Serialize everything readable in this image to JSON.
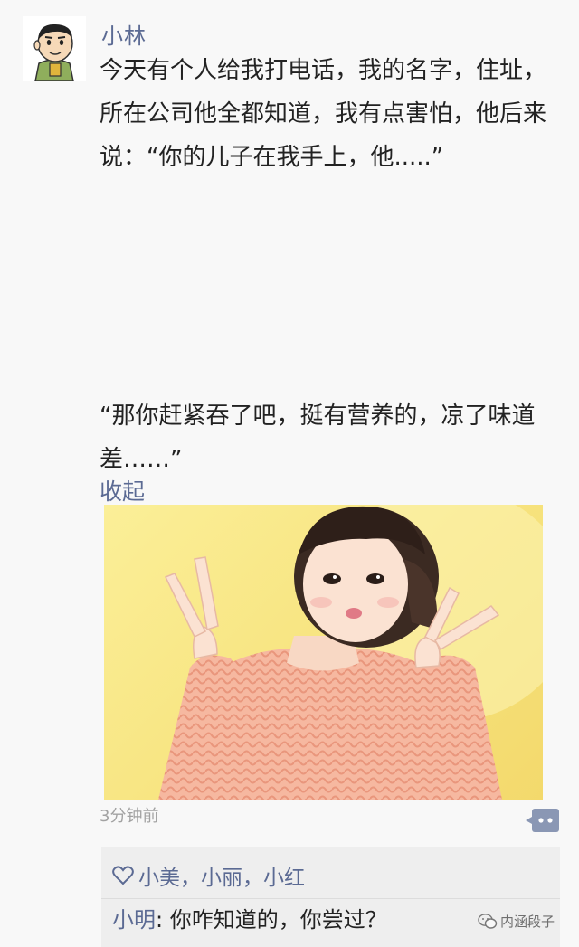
{
  "post": {
    "author": "小林",
    "avatar_icon": "cartoon-man-avatar-icon",
    "text_lines": [
      "今天有个人给我打电话，我的名字，住址，",
      "所在公司他全都知道，我有点害怕，他后来",
      "说：“你的儿子在我手上，他.....”"
    ],
    "text2_lines": [
      "“那你赶紧吞了吧，挺有营养的，凉了味道",
      "差……”"
    ],
    "collapse_label": "收起",
    "image_icon": "photo-girl-peace-sign",
    "time": "3分钟前",
    "comment_icon": "comment-dots-icon"
  },
  "likes": {
    "icon": "heart-icon",
    "names": "小美，小丽，小红"
  },
  "comment": {
    "author": "小明",
    "separator": ": ",
    "text": "你咋知道的，你尝过？"
  },
  "watermark": {
    "icon": "wechat-icon",
    "text": "内涵段子"
  },
  "colors": {
    "link": "#5b6a93",
    "text": "#222222",
    "meta": "#a2a2a2",
    "likes_bg": "#eeeeee",
    "page_bg": "#f8f8f8"
  }
}
